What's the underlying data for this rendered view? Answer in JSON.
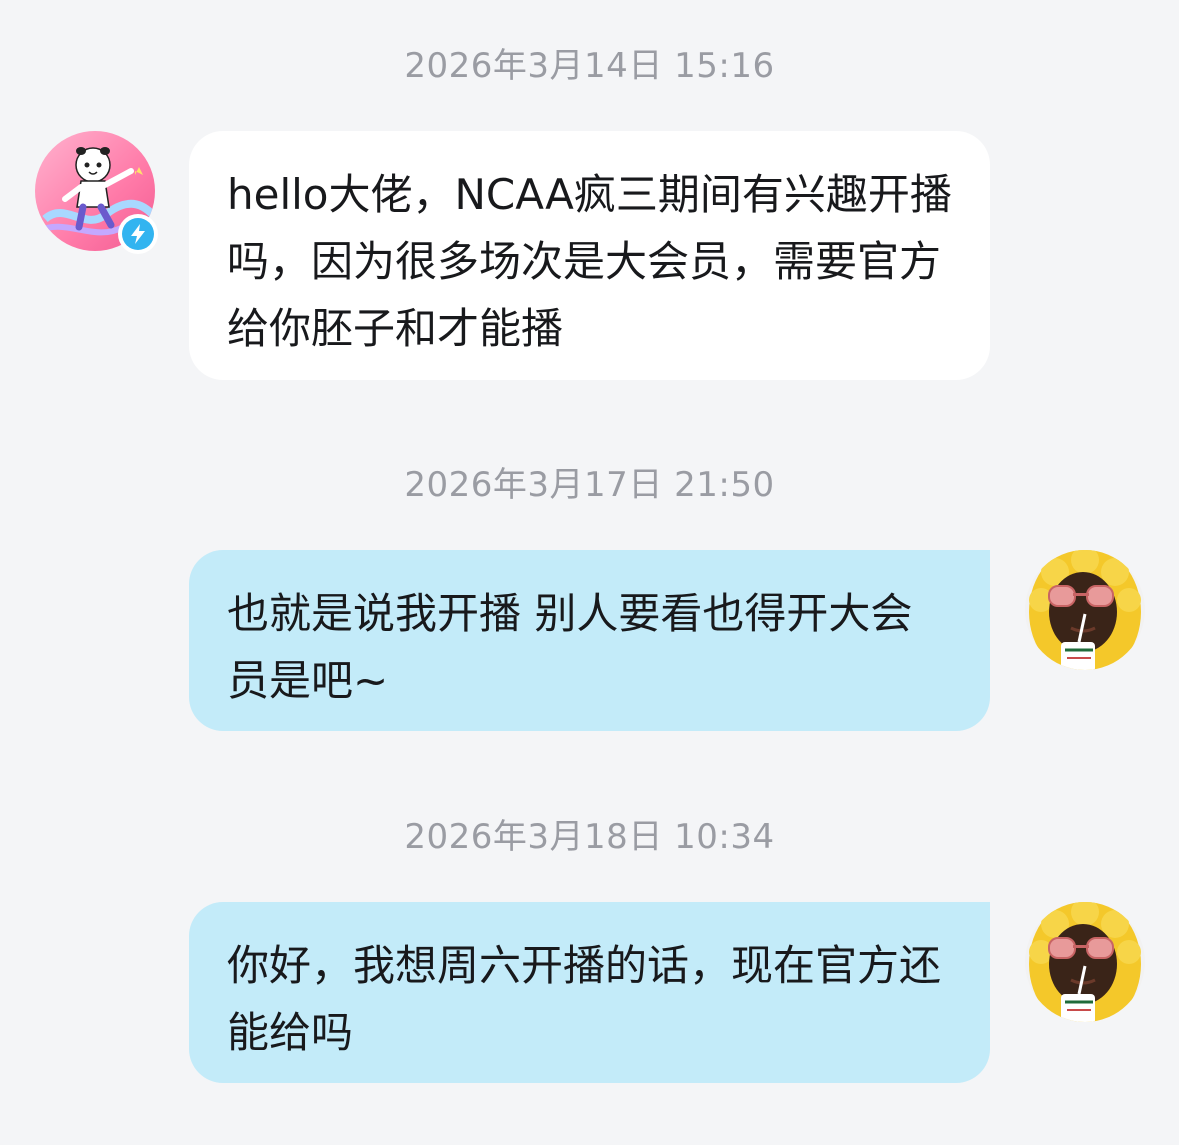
{
  "conversation": {
    "messages": [
      {
        "timestamp": "2026年3月14日 15:16",
        "direction": "incoming",
        "text": "hello大佬，NCAA疯三期间有兴趣开播吗，因为很多场次是大会员，需要官方给你胚子和才能播",
        "avatar_icon": "panda-character-avatar",
        "badge_icon": "lightning-bolt-icon"
      },
      {
        "timestamp": "2026年3月17日 21:50",
        "direction": "outgoing",
        "text": "也就是说我开播 别人要看也得开大会员是吧~",
        "avatar_icon": "person-yellow-hood-sunglasses-avatar"
      },
      {
        "timestamp": "2026年3月18日 10:34",
        "direction": "outgoing",
        "text": "你好，我想周六开播的话，现在官方还能给吗",
        "avatar_icon": "person-yellow-hood-sunglasses-avatar"
      }
    ]
  },
  "colors": {
    "background": "#f4f5f7",
    "incoming_bubble": "#ffffff",
    "outgoing_bubble": "#c3ebf9",
    "timestamp_text": "#9a9ca3",
    "message_text": "#18191c",
    "badge": "#32b4f0"
  }
}
